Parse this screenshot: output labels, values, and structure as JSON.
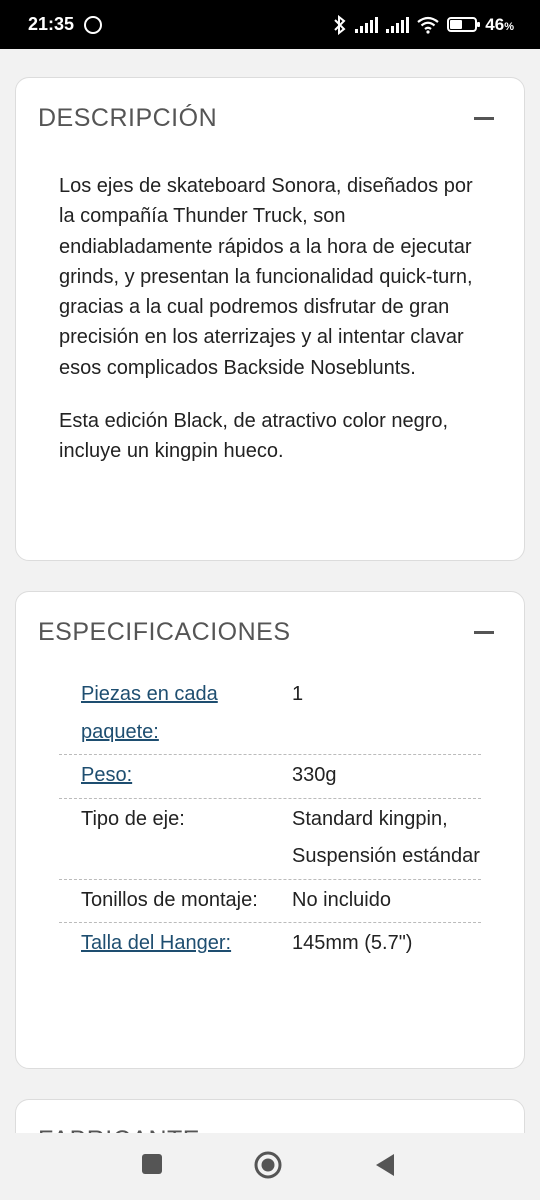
{
  "status_bar": {
    "time": "21:35",
    "battery_level": "46",
    "battery_unit": "%"
  },
  "description": {
    "title": "DESCRIPCIÓN",
    "paragraphs": [
      "Los ejes de skateboard Sonora, diseñados por la compañía Thunder Truck, son endiabladamente rápidos a la hora de ejecutar grinds, y presentan la funcionalidad quick-turn, gracias a la cual podremos disfrutar de gran precisión en los aterrizajes y al intentar clavar esos complicados Backside Noseblunts.",
      "Esta edición Black, de atractivo color negro, incluye un kingpin hueco."
    ]
  },
  "specifications": {
    "title": "ESPECIFICACIONES",
    "rows": [
      {
        "label": "Piezas en cada paquete:",
        "value": "1"
      },
      {
        "label": "Peso:",
        "value": "330g"
      },
      {
        "label": "Tipo de eje:",
        "value": "Standard kingpin, Suspensión estándar"
      },
      {
        "label": "Tonillos de montaje:",
        "value": "No incluido"
      },
      {
        "label": "Talla del Hanger:",
        "value": "145mm (5.7\")"
      }
    ]
  },
  "manufacturer": {
    "title": "FABRICANTE"
  },
  "colors": {
    "link": "#1e4e70",
    "card_title": "#555555",
    "background": "#f2f2f2"
  }
}
